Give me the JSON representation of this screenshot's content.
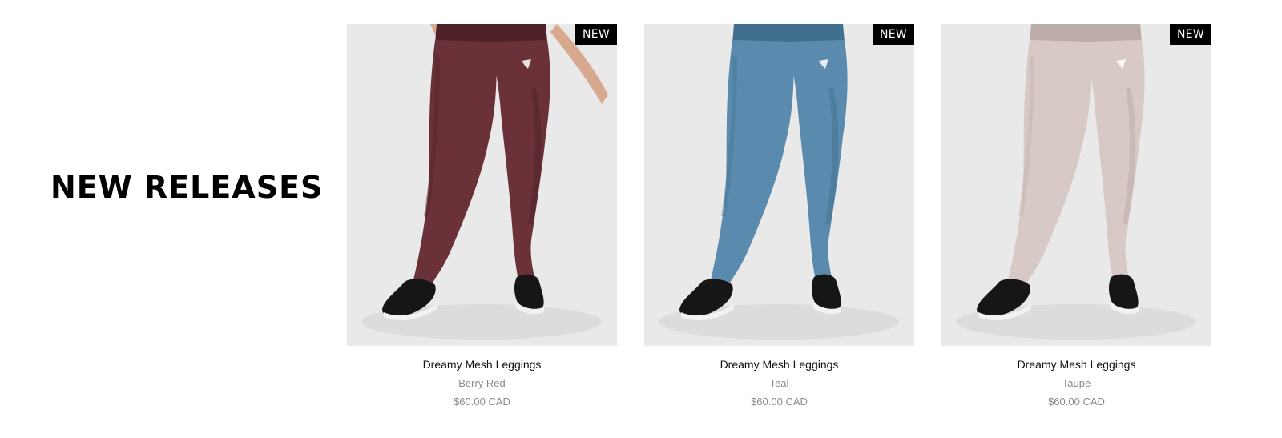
{
  "section": {
    "title": "NEW RELEASES"
  },
  "products": [
    {
      "badge": "NEW",
      "name": "Dreamy Mesh Leggings",
      "color_name": "Berry Red",
      "price": "$60.00 CAD",
      "swatch": "#6a3139",
      "swatch_dark": "#4f2128",
      "skin": "#d7a98e"
    },
    {
      "badge": "NEW",
      "name": "Dreamy Mesh Leggings",
      "color_name": "Teal",
      "price": "$60.00 CAD",
      "swatch": "#5a8aad",
      "swatch_dark": "#41708f",
      "skin": "#d7a98e"
    },
    {
      "badge": "NEW",
      "name": "Dreamy Mesh Leggings",
      "color_name": "Taupe",
      "price": "$60.00 CAD",
      "swatch": "#d7c9c6",
      "swatch_dark": "#bcaca8",
      "skin": "#e2b59a"
    }
  ]
}
